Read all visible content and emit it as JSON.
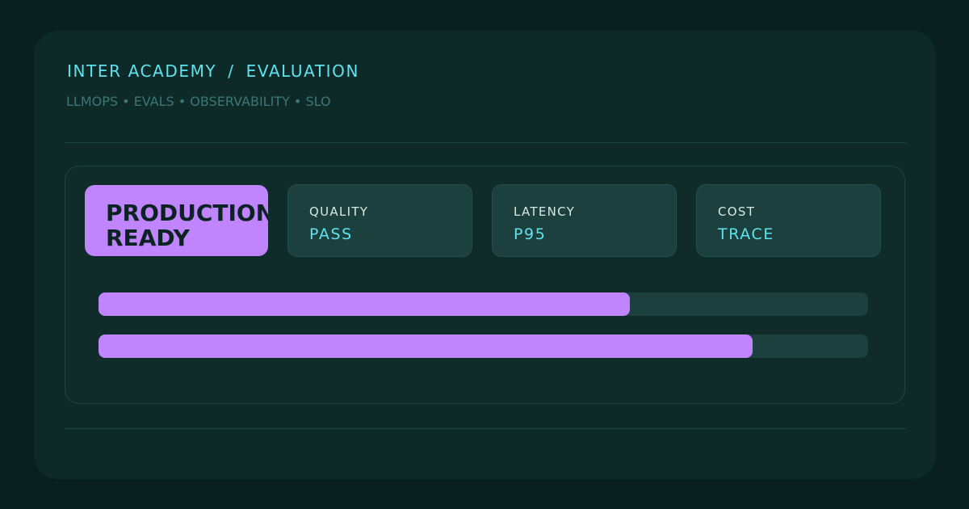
{
  "header": {
    "breadcrumb": [
      "INTER ACADEMY",
      "EVALUATION"
    ],
    "separator": "/",
    "tagline": "LLMOPS • EVALS • OBSERVABILITY • SLO"
  },
  "badge": {
    "lines": [
      "PRODUCTION",
      "READY"
    ]
  },
  "stats": [
    {
      "label": "QUALITY",
      "value": "PASS"
    },
    {
      "label": "LATENCY",
      "value": "P95"
    },
    {
      "label": "COST",
      "value": "TRACE"
    }
  ],
  "progress_bars": [
    {
      "percent": 69
    },
    {
      "percent": 85
    }
  ],
  "colors": {
    "background": "#0a1f1f",
    "card": "#0d2a29",
    "accent": "#c084fc",
    "highlight": "#5fe3ee",
    "muted": "#3d7773"
  }
}
